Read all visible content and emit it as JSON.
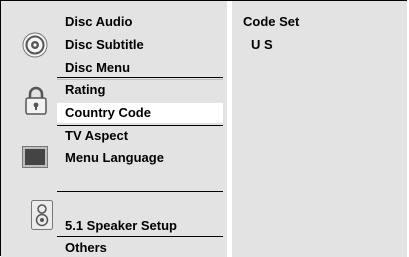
{
  "menu": {
    "disc_audio": "Disc Audio",
    "disc_subtitle": "Disc Subtitle",
    "disc_menu": "Disc Menu",
    "rating": "Rating",
    "country_code": "Country Code",
    "tv_aspect": "TV Aspect",
    "menu_language": "Menu Language",
    "speaker_setup": "5.1 Speaker Setup",
    "others": "Others"
  },
  "panel": {
    "title": "Code Set",
    "value": "U S"
  },
  "icons": {
    "disc": "disc-icon",
    "lock": "lock-icon",
    "tv": "tv-screen-icon",
    "speaker": "speaker-icon"
  }
}
